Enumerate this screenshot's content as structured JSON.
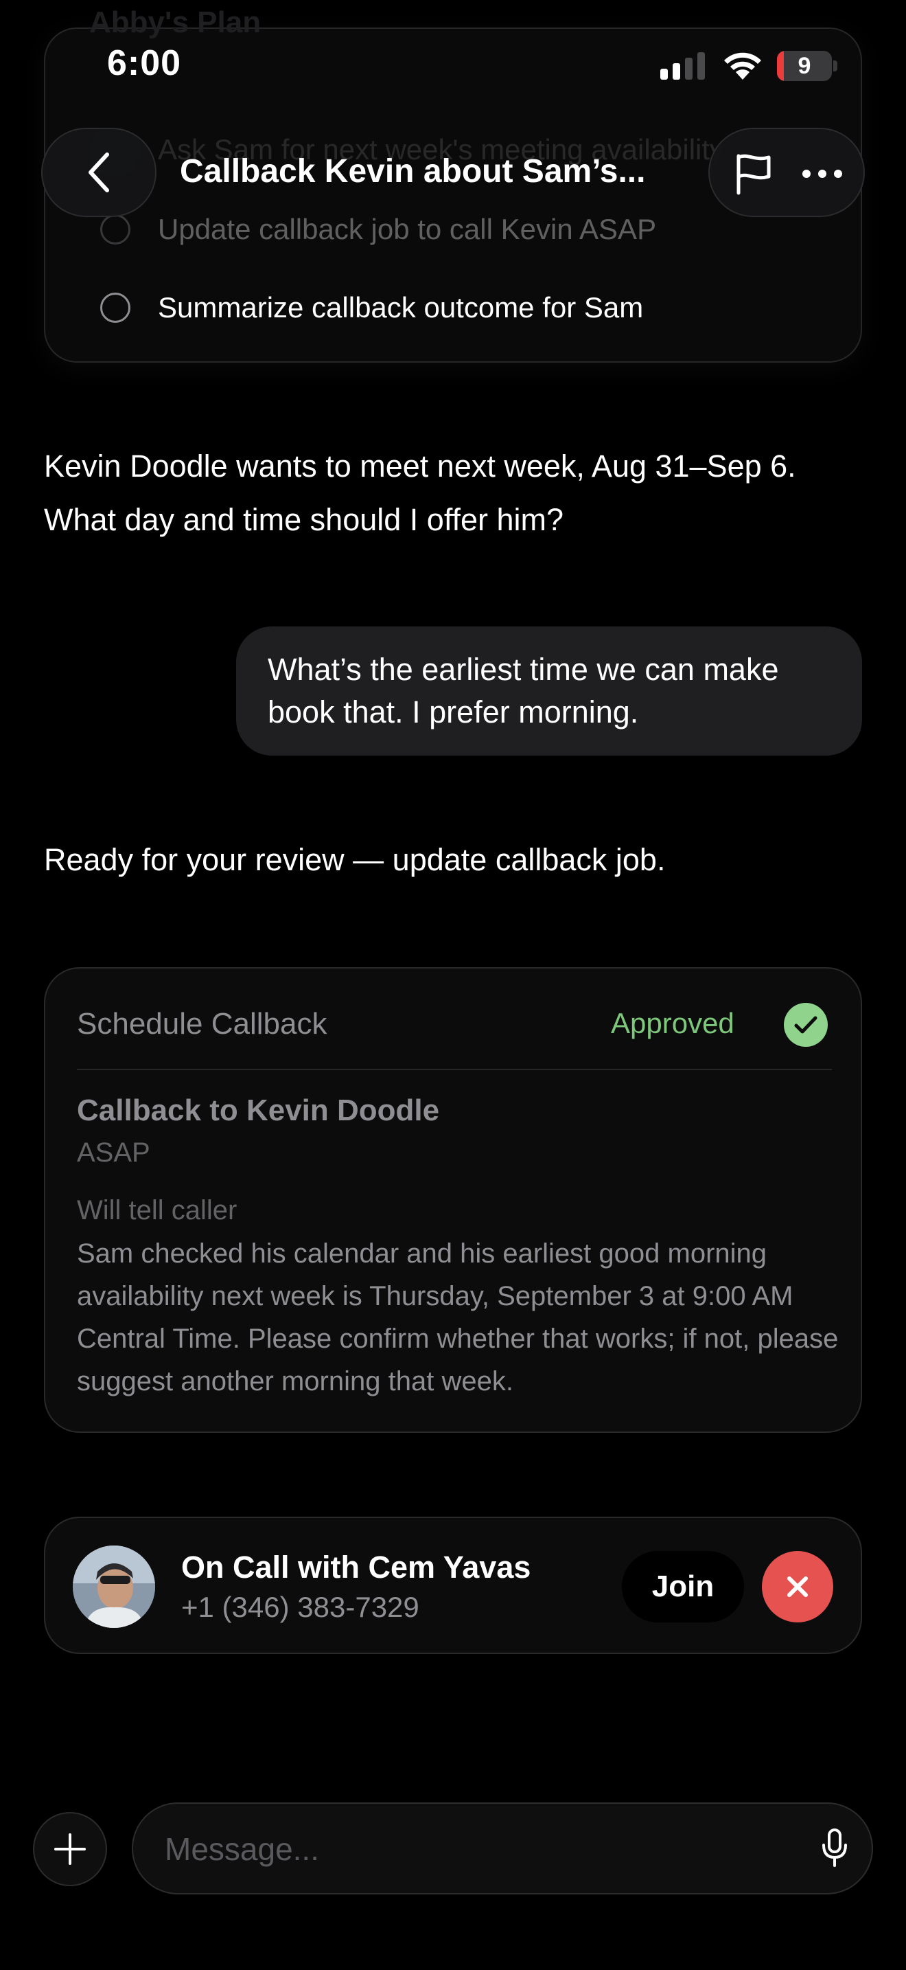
{
  "plan": {
    "title": "Abby's Plan",
    "items": [
      {
        "label": "Ask Sam for next week's meeting availability"
      },
      {
        "label": "Update callback job to call Kevin ASAP"
      },
      {
        "label": "Summarize callback outcome for Sam"
      }
    ]
  },
  "status_bar": {
    "time": "6:00",
    "battery_level": "9",
    "battery_fraction": 0.09
  },
  "header": {
    "title": "Callback Kevin about Sam’s..."
  },
  "messages": {
    "assistant_1": "Kevin Doodle wants to meet next week, Aug 31–Sep 6. What day and time should I offer him?",
    "user_1": "What’s the earliest time we can make book that. I prefer morning.",
    "assistant_2": "Ready for your review — update callback job."
  },
  "review_card": {
    "action": "Schedule Callback",
    "status": "Approved",
    "status_color": "#7dc87a",
    "target": "Callback to Kevin Doodle",
    "when": "ASAP",
    "message_label": "Will tell caller",
    "message_body": "Sam checked his calendar and his earliest good morning availability next week is Thursday, September 3 at 9:00 AM Central Time. Please confirm whether that works; if not, please suggest another morning that week."
  },
  "call": {
    "title": "On Call with Cem Yavas",
    "phone": "+1 (346) 383-7329",
    "join_label": "Join",
    "end_color": "#e5524f"
  },
  "composer": {
    "placeholder": "Message..."
  }
}
